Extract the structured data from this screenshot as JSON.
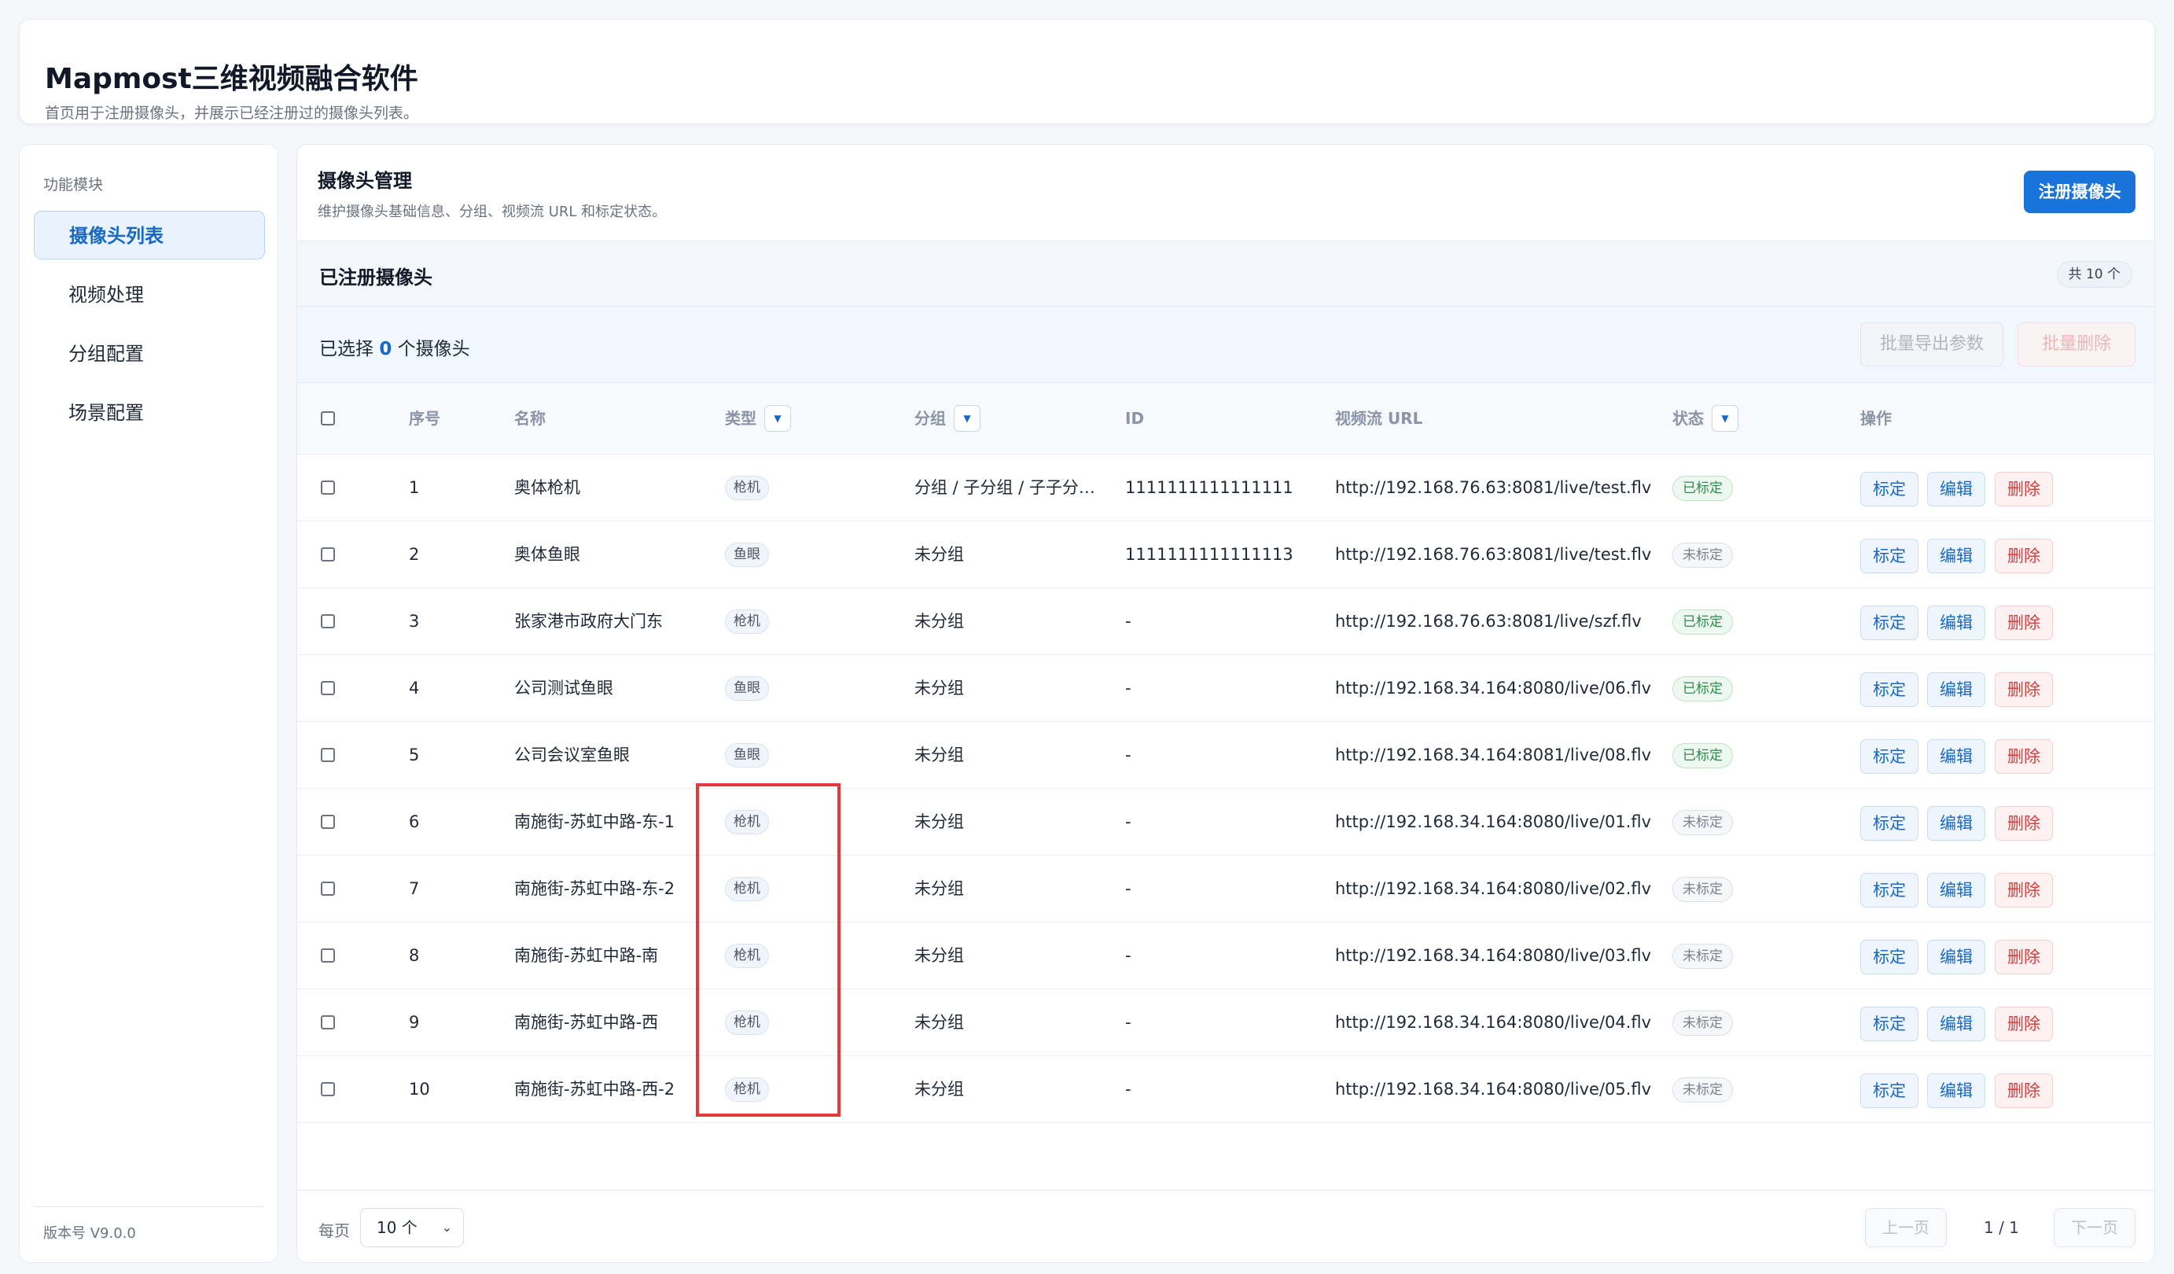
{
  "app": {
    "title": "Mapmost三维视频融合软件",
    "subtitle": "首页用于注册摄像头，并展示已经注册过的摄像头列表。"
  },
  "sidebar": {
    "section_label": "功能模块",
    "items": [
      {
        "label": "摄像头列表",
        "active": true
      },
      {
        "label": "视频处理",
        "active": false
      },
      {
        "label": "分组配置",
        "active": false
      },
      {
        "label": "场景配置",
        "active": false
      }
    ],
    "version": "版本号 V9.0.0"
  },
  "main": {
    "title": "摄像头管理",
    "subtitle": "维护摄像头基础信息、分组、视频流 URL 和标定状态。",
    "register_button": "注册摄像头"
  },
  "card": {
    "title": "已注册摄像头",
    "count": "共 10 个",
    "selection_prefix": "已选择",
    "selection_count": "0",
    "selection_suffix": "个摄像头",
    "batch_export": "批量导出参数",
    "batch_delete": "批量删除"
  },
  "table": {
    "headers": {
      "index": "序号",
      "name": "名称",
      "type": "类型",
      "group": "分组",
      "id": "ID",
      "url": "视频流 URL",
      "status": "状态",
      "actions": "操作"
    },
    "action_labels": {
      "calibrate": "标定",
      "edit": "编辑",
      "delete": "删除"
    },
    "rows": [
      {
        "index": "1",
        "name": "奥体枪机",
        "type": "枪机",
        "group": "分组 / 子分组 / 子子分…",
        "id": "1111111111111111",
        "url": "http://192.168.76.63:8081/live/test.flv",
        "status": "已标定",
        "calibrated": true
      },
      {
        "index": "2",
        "name": "奥体鱼眼",
        "type": "鱼眼",
        "group": "未分组",
        "id": "1111111111111113",
        "url": "http://192.168.76.63:8081/live/test.flv",
        "status": "未标定",
        "calibrated": false
      },
      {
        "index": "3",
        "name": "张家港市政府大门东",
        "type": "枪机",
        "group": "未分组",
        "id": "-",
        "url": "http://192.168.76.63:8081/live/szf.flv",
        "status": "已标定",
        "calibrated": true
      },
      {
        "index": "4",
        "name": "公司测试鱼眼",
        "type": "鱼眼",
        "group": "未分组",
        "id": "-",
        "url": "http://192.168.34.164:8080/live/06.flv",
        "status": "已标定",
        "calibrated": true
      },
      {
        "index": "5",
        "name": "公司会议室鱼眼",
        "type": "鱼眼",
        "group": "未分组",
        "id": "-",
        "url": "http://192.168.34.164:8081/live/08.flv",
        "status": "已标定",
        "calibrated": true
      },
      {
        "index": "6",
        "name": "南施街-苏虹中路-东-1",
        "type": "枪机",
        "group": "未分组",
        "id": "-",
        "url": "http://192.168.34.164:8080/live/01.flv",
        "status": "未标定",
        "calibrated": false
      },
      {
        "index": "7",
        "name": "南施街-苏虹中路-东-2",
        "type": "枪机",
        "group": "未分组",
        "id": "-",
        "url": "http://192.168.34.164:8080/live/02.flv",
        "status": "未标定",
        "calibrated": false
      },
      {
        "index": "8",
        "name": "南施街-苏虹中路-南",
        "type": "枪机",
        "group": "未分组",
        "id": "-",
        "url": "http://192.168.34.164:8080/live/03.flv",
        "status": "未标定",
        "calibrated": false
      },
      {
        "index": "9",
        "name": "南施街-苏虹中路-西",
        "type": "枪机",
        "group": "未分组",
        "id": "-",
        "url": "http://192.168.34.164:8080/live/04.flv",
        "status": "未标定",
        "calibrated": false
      },
      {
        "index": "10",
        "name": "南施街-苏虹中路-西-2",
        "type": "枪机",
        "group": "未分组",
        "id": "-",
        "url": "http://192.168.34.164:8080/live/05.flv",
        "status": "未标定",
        "calibrated": false
      }
    ]
  },
  "pagination": {
    "per_page_label": "每页",
    "per_page_value": "10 个",
    "prev": "上一页",
    "page_info": "1 / 1",
    "next": "下一页"
  },
  "colors": {
    "primary": "#1a73d9",
    "highlight_box": "#e0393e",
    "calibrated": "#2f8a4c",
    "delete": "#d43f3f"
  }
}
